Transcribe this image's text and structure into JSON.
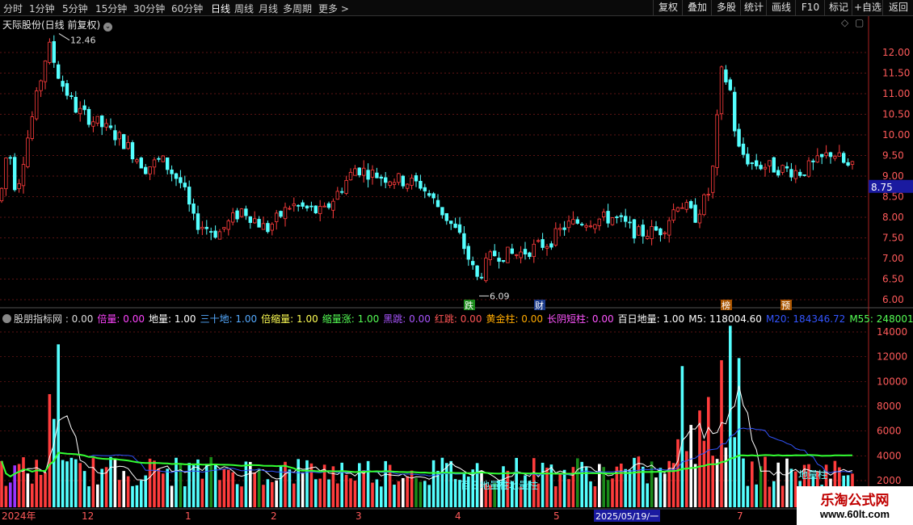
{
  "toolbar": {
    "periods": [
      "分时",
      "1分钟",
      "5分钟",
      "15分钟",
      "30分钟",
      "60分钟",
      "日线",
      "周线",
      "月线",
      "多周期",
      "更多 >"
    ],
    "active_period": "日线",
    "right_buttons": [
      "复权",
      "叠加",
      "多股",
      "统计",
      "画线",
      "F10",
      "+自选",
      "返回"
    ]
  },
  "main_panel": {
    "stock_title": "天际股份(日线 前复权)",
    "price_ticks": [
      "12.00",
      "11.50",
      "11.00",
      "10.50",
      "10.00",
      "9.50",
      "9.00",
      "8.50",
      "8.00",
      "7.50",
      "7.00",
      "6.50",
      "6.00"
    ],
    "current_price": "8.75",
    "high_label": "12.46",
    "low_label": "6.09",
    "markers": [
      "跌",
      "财",
      "榜",
      "预"
    ]
  },
  "indicator_panel": {
    "name": "股朋指标网",
    "items": [
      {
        "label": "股朋指标网",
        "value": "0.00",
        "color": "#dddddd"
      },
      {
        "label": "倍量",
        "value": "0.00",
        "color": "#ff44ff"
      },
      {
        "label": "地量",
        "value": "1.00",
        "color": "#ffffff"
      },
      {
        "label": "三十地",
        "value": "1.00",
        "color": "#55aaff"
      },
      {
        "label": "倍缩量",
        "value": "1.00",
        "color": "#ffff55"
      },
      {
        "label": "缩量涨",
        "value": "1.00",
        "color": "#55ff55"
      },
      {
        "label": "黑跳",
        "value": "0.00",
        "color": "#aa55ff"
      },
      {
        "label": "红跳",
        "value": "0.00",
        "color": "#ff5555"
      },
      {
        "label": "黄金柱",
        "value": "0.00",
        "color": "#ffaa00"
      },
      {
        "label": "长阴短柱",
        "value": "0.00",
        "color": "#ff55ff"
      },
      {
        "label": "百日地量",
        "value": "1.00",
        "color": "#ffffff"
      },
      {
        "label": "M5",
        "value": "118004.60",
        "color": "#ffffff"
      },
      {
        "label": "M20",
        "value": "184346.72",
        "color": "#3355ff"
      },
      {
        "label": "M55",
        "value": "248001.31",
        "color": "#55ff55"
      }
    ],
    "volume_ticks": [
      "14000",
      "12000",
      "10000",
      "8000",
      "6000",
      "4000",
      "2000"
    ],
    "inline_texts": [
      "百日地量柱",
      "地量柱",
      "地量柱"
    ]
  },
  "date_axis": {
    "labels": [
      "2024年",
      "12",
      "1",
      "2",
      "3",
      "4",
      "5",
      "7"
    ],
    "cursor_date": "2025/05/19/一"
  },
  "watermark": {
    "line1": "乐淘公式网",
    "line2": "www.60lt.com"
  },
  "colors": {
    "up": "#ff3c3c",
    "down": "#54ffff",
    "ma5": "#ffffff",
    "ma20": "#3355ff",
    "ma55": "#33ff33",
    "grid": "#7a1a1a",
    "axis": "#aa2222"
  }
}
